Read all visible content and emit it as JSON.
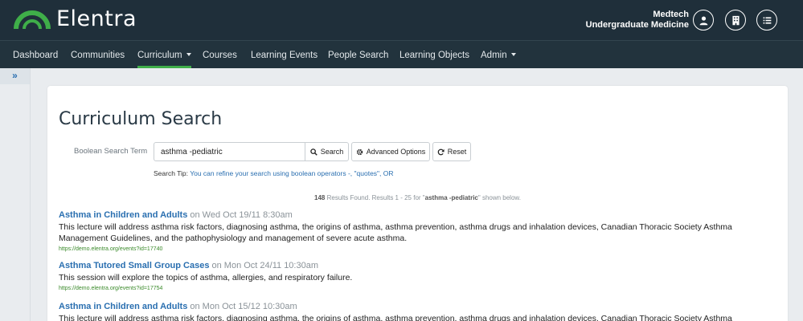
{
  "header": {
    "logo_text": "Elentra",
    "org_line1": "Medtech",
    "org_line2": "Undergraduate Medicine",
    "icons": [
      "user-icon",
      "building-icon",
      "list-icon"
    ]
  },
  "nav": {
    "items": [
      {
        "label": "Dashboard"
      },
      {
        "label": "Communities"
      },
      {
        "label": "Curriculum"
      },
      {
        "label": "Courses"
      },
      {
        "label": "Learning Events"
      },
      {
        "label": "People Search"
      },
      {
        "label": "Learning Objects"
      },
      {
        "label": "Admin"
      }
    ],
    "active_index": 2
  },
  "page": {
    "title": "Curriculum Search"
  },
  "search": {
    "label": "Boolean Search Term",
    "value": "asthma -pediatric",
    "search_label": "Search",
    "advanced_label": "Advanced Options",
    "reset_label": "Reset",
    "tip_prefix": "Search Tip:",
    "tip_text": "You can refine your search using boolean operators -, \"quotes\", OR"
  },
  "summary": {
    "count": "148",
    "text_a": " Results Found. Results 1 - 25 for \"",
    "term": "asthma -pediatric",
    "text_b": "\" shown below."
  },
  "results": [
    {
      "title": "Asthma in Children and Adults",
      "date": " on Wed Oct 19/11 8:30am",
      "description": "This lecture will address asthma risk factors, diagnosing asthma, the origins of asthma, asthma prevention, asthma drugs and inhalation devices, Canadian Thoracic Society Asthma Management Guidelines, and the pathophysiology and management of severe acute asthma.",
      "url": "https://demo.elentra.org/events?id=17740"
    },
    {
      "title": "Asthma Tutored Small Group Cases",
      "date": " on Mon Oct 24/11 10:30am",
      "description": "This session will explore the topics of asthma, allergies, and respiratory failure.",
      "url": "https://demo.elentra.org/events?id=17754"
    },
    {
      "title": "Asthma in Children and Adults",
      "date": " on Mon Oct 15/12 10:30am",
      "description": "This lecture will address asthma risk factors, diagnosing asthma, the origins of asthma, asthma prevention, asthma drugs and inhalation devices, Canadian Thoracic Society Asthma",
      "url": ""
    }
  ],
  "colors": {
    "header_bg": "#1f2f3a",
    "nav_bg": "#22333d",
    "active_underline": "#3fae49",
    "link": "#2a6fb0",
    "url_green": "#3a8a2a"
  }
}
